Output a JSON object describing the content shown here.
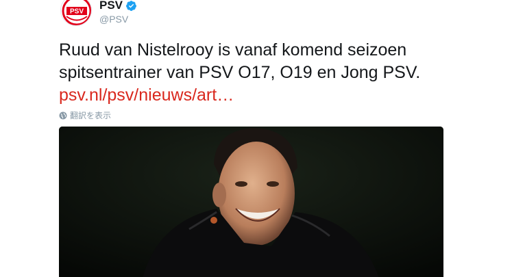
{
  "account": {
    "display_name": "PSV",
    "handle": "@PSV",
    "verified": true,
    "avatar_icon": "psv-logo-icon",
    "avatar_logo_text": "PSV"
  },
  "tweet": {
    "text": "Ruud van Nistelrooy is vanaf komend seizoen spitsentrainer van PSV O17, O19 en Jong PSV. ",
    "link_text": "psv.nl/psv/nieuws/art…"
  },
  "translate": {
    "label": "翻訳を表示",
    "icon": "globe-icon"
  },
  "colors": {
    "link": "#d9281e",
    "handle": "#8899a6",
    "verified": "#1da1f2",
    "psv_red": "#e2001a"
  }
}
